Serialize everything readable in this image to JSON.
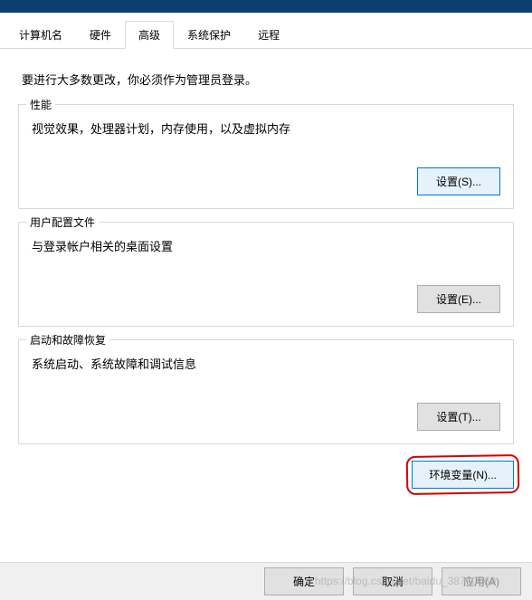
{
  "tabs": {
    "computer_name": "计算机名",
    "hardware": "硬件",
    "advanced": "高级",
    "system_protection": "系统保护",
    "remote": "远程"
  },
  "intro": "要进行大多数更改，你必须作为管理员登录。",
  "performance": {
    "title": "性能",
    "desc": "视觉效果，处理器计划，内存使用，以及虚拟内存",
    "button": "设置(S)..."
  },
  "user_profiles": {
    "title": "用户配置文件",
    "desc": "与登录帐户相关的桌面设置",
    "button": "设置(E)..."
  },
  "startup_recovery": {
    "title": "启动和故障恢复",
    "desc": "系统启动、系统故障和调试信息",
    "button": "设置(T)..."
  },
  "env_button": "环境变量(N)...",
  "bottom": {
    "ok": "确定",
    "cancel": "取消",
    "apply": "应用(A)"
  },
  "watermark": "https://blog.csdn.net/baidu_38760069"
}
